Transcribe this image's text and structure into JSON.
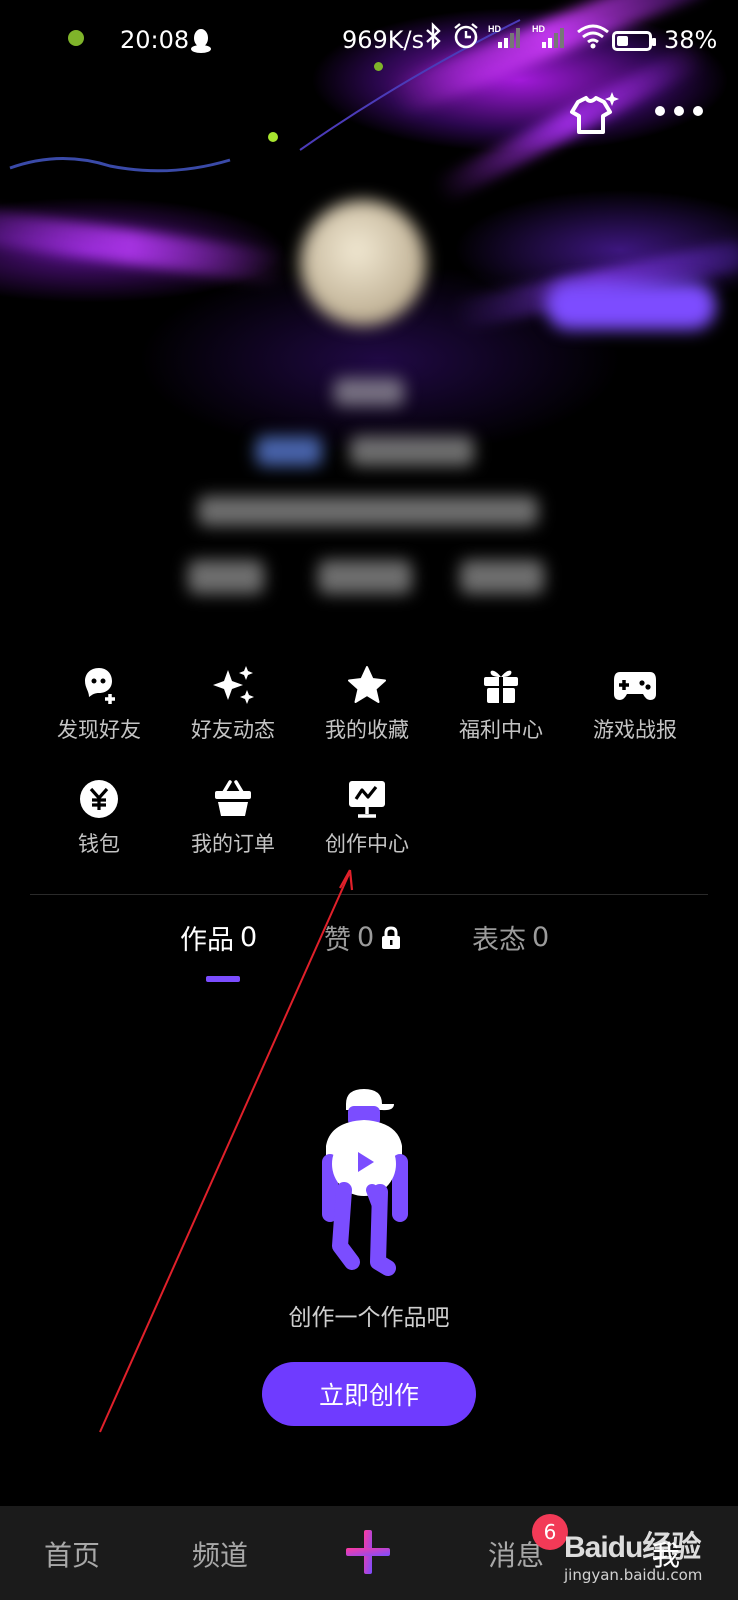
{
  "status_bar": {
    "time": "20:08",
    "net_speed": "969K/s",
    "battery_text": "38%",
    "battery_level": 0.38,
    "icons": [
      "qq-icon",
      "bluetooth-icon",
      "alarm-icon",
      "signal-hd-icon",
      "signal-hd-icon",
      "wifi-icon",
      "battery-icon"
    ]
  },
  "header": {
    "icons": [
      "shirt-sparkle-icon",
      "more-icon"
    ]
  },
  "shortcuts": [
    {
      "label": "发现好友",
      "icon": "find-friends-icon"
    },
    {
      "label": "好友动态",
      "icon": "sparkle-icon"
    },
    {
      "label": "我的收藏",
      "icon": "star-icon"
    },
    {
      "label": "福利中心",
      "icon": "gift-icon"
    },
    {
      "label": "游戏战报",
      "icon": "gamepad-icon"
    },
    {
      "label": "钱包",
      "icon": "yuan-icon"
    },
    {
      "label": "我的订单",
      "icon": "basket-icon"
    },
    {
      "label": "创作中心",
      "icon": "monitor-chart-icon"
    }
  ],
  "tabs": [
    {
      "label": "作品",
      "count": "0",
      "active": true
    },
    {
      "label": "赞",
      "count": "0",
      "locked": true
    },
    {
      "label": "表态",
      "count": "0"
    }
  ],
  "empty_state": {
    "text": "创作一个作品吧",
    "button": "立即创作"
  },
  "bottom_nav": {
    "items": [
      "首页",
      "频道",
      "消息",
      "我"
    ],
    "badge": "6"
  },
  "watermark": {
    "logo": "Baidu经验",
    "url": "jingyan.baidu.com"
  },
  "colors": {
    "accent": "#7b4dff",
    "button": "#6f3bff",
    "badge": "#f23a57",
    "annotation": "#e0202a"
  }
}
